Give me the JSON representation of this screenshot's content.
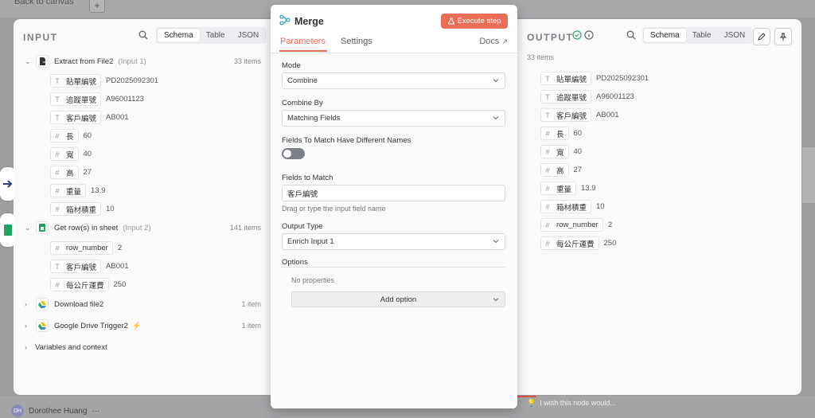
{
  "background": {
    "back_to_canvas": "Back to canvas",
    "user_initials": "DH",
    "user_name": "Dorothee Huang",
    "user_more": "···",
    "wish_text": "I wish this node would..."
  },
  "input_panel": {
    "title": "INPUT",
    "view_tabs": [
      "Schema",
      "Table",
      "JSON"
    ],
    "active_view": "Schema",
    "nodes": [
      {
        "name": "Extract from File2",
        "sub": "(Input 1)",
        "count": "33 items",
        "icon": "file-extract-icon",
        "expanded": true,
        "fields": [
          {
            "type": "T",
            "key": "貼單編號",
            "value": "PD2025092301"
          },
          {
            "type": "T",
            "key": "追蹤單號",
            "value": "A96001123"
          },
          {
            "type": "T",
            "key": "客戶編號",
            "value": "AB001"
          },
          {
            "type": "#",
            "key": "長",
            "value": "60"
          },
          {
            "type": "#",
            "key": "寬",
            "value": "40"
          },
          {
            "type": "#",
            "key": "高",
            "value": "27"
          },
          {
            "type": "#",
            "key": "重量",
            "value": "13.9"
          },
          {
            "type": "#",
            "key": "箱材積重",
            "value": "10"
          }
        ]
      },
      {
        "name": "Get row(s) in sheet",
        "sub": "(Input 2)",
        "count": "141 items",
        "icon": "google-sheets-icon",
        "expanded": true,
        "fields": [
          {
            "type": "#",
            "key": "row_number",
            "value": "2"
          },
          {
            "type": "T",
            "key": "客戶編號",
            "value": "AB001"
          },
          {
            "type": "#",
            "key": "每公斤運費",
            "value": "250"
          }
        ]
      },
      {
        "name": "Download file2",
        "sub": "",
        "count": "1 item",
        "icon": "google-drive-icon",
        "expanded": false,
        "fields": []
      },
      {
        "name": "Google Drive Trigger2",
        "sub": "",
        "count": "1 item",
        "icon": "google-drive-icon",
        "expanded": false,
        "fields": []
      }
    ],
    "variables": "Variables and context"
  },
  "modal": {
    "title": "Merge",
    "execute_label": "Execute step",
    "tabs": [
      "Parameters",
      "Settings"
    ],
    "active_tab": "Parameters",
    "docs_label": "Docs",
    "mode_label": "Mode",
    "mode_value": "Combine",
    "combine_by_label": "Combine By",
    "combine_by_value": "Matching Fields",
    "diff_names_label": "Fields To Match Have Different Names",
    "diff_names_on": false,
    "fields_to_match_label": "Fields to Match",
    "fields_to_match_value": "客戶編號",
    "fields_to_match_hint": "Drag or type the input field name",
    "output_type_label": "Output Type",
    "output_type_value": "Enrich Input 1",
    "options_label": "Options",
    "no_properties": "No properties",
    "add_option": "Add option"
  },
  "output_panel": {
    "title": "OUTPUT",
    "view_tabs": [
      "Schema",
      "Table",
      "JSON"
    ],
    "active_view": "Schema",
    "count": "33 items",
    "fields": [
      {
        "type": "T",
        "key": "貼單編號",
        "value": "PD2025092301"
      },
      {
        "type": "T",
        "key": "追蹤單號",
        "value": "A96001123"
      },
      {
        "type": "T",
        "key": "客戶編號",
        "value": "AB001"
      },
      {
        "type": "#",
        "key": "長",
        "value": "60"
      },
      {
        "type": "#",
        "key": "寬",
        "value": "40"
      },
      {
        "type": "#",
        "key": "高",
        "value": "27"
      },
      {
        "type": "#",
        "key": "重量",
        "value": "13.9"
      },
      {
        "type": "#",
        "key": "箱材積重",
        "value": "10"
      },
      {
        "type": "#",
        "key": "row_number",
        "value": "2"
      },
      {
        "type": "#",
        "key": "每公斤運費",
        "value": "250"
      }
    ]
  },
  "colors": {
    "accent": "#ea6d55",
    "success": "#3fa06a"
  }
}
